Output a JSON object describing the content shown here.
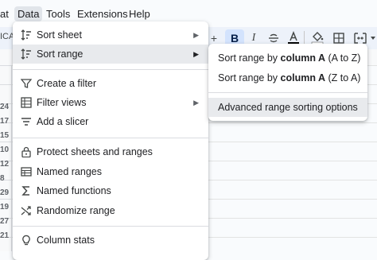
{
  "menubar": {
    "items": [
      "at",
      "Data",
      "Tools",
      "Extensions",
      "Help"
    ]
  },
  "toolbar": {
    "font_fragment": "ICAS",
    "plus": "+",
    "bold": "B",
    "italic": "I"
  },
  "row_numbers": [
    "24",
    "17",
    "15",
    "10",
    "12",
    "8",
    "29",
    "19",
    "27",
    "21"
  ],
  "data_menu": {
    "items": [
      {
        "label": "Sort sheet",
        "icon": "sort-icon",
        "submenu": true
      },
      {
        "label": "Sort range",
        "icon": "sort-icon",
        "submenu": true
      },
      {
        "label": "Create a filter",
        "icon": "filter-icon"
      },
      {
        "label": "Filter views",
        "icon": "filter-views-icon",
        "submenu": true
      },
      {
        "label": "Add a slicer",
        "icon": "slicer-icon"
      },
      {
        "label": "Protect sheets and ranges",
        "icon": "lock-icon"
      },
      {
        "label": "Named ranges",
        "icon": "named-ranges-icon"
      },
      {
        "label": "Named functions",
        "icon": "sigma-icon"
      },
      {
        "label": "Randomize range",
        "icon": "shuffle-icon"
      },
      {
        "label": "Column stats",
        "icon": "lightbulb-icon"
      }
    ]
  },
  "sort_range_submenu": {
    "asc_prefix": "Sort range by ",
    "asc_column": "column A",
    "asc_suffix": " (A to Z)",
    "desc_prefix": "Sort range by ",
    "desc_column": "column A",
    "desc_suffix": " (Z to A)",
    "advanced": "Advanced range sorting options"
  },
  "colors": {
    "menu_bg": "#ffffff",
    "highlight": "#e8eaed",
    "toolbar_bg": "#edf2fa",
    "bold_active": "#d3e3fd"
  }
}
